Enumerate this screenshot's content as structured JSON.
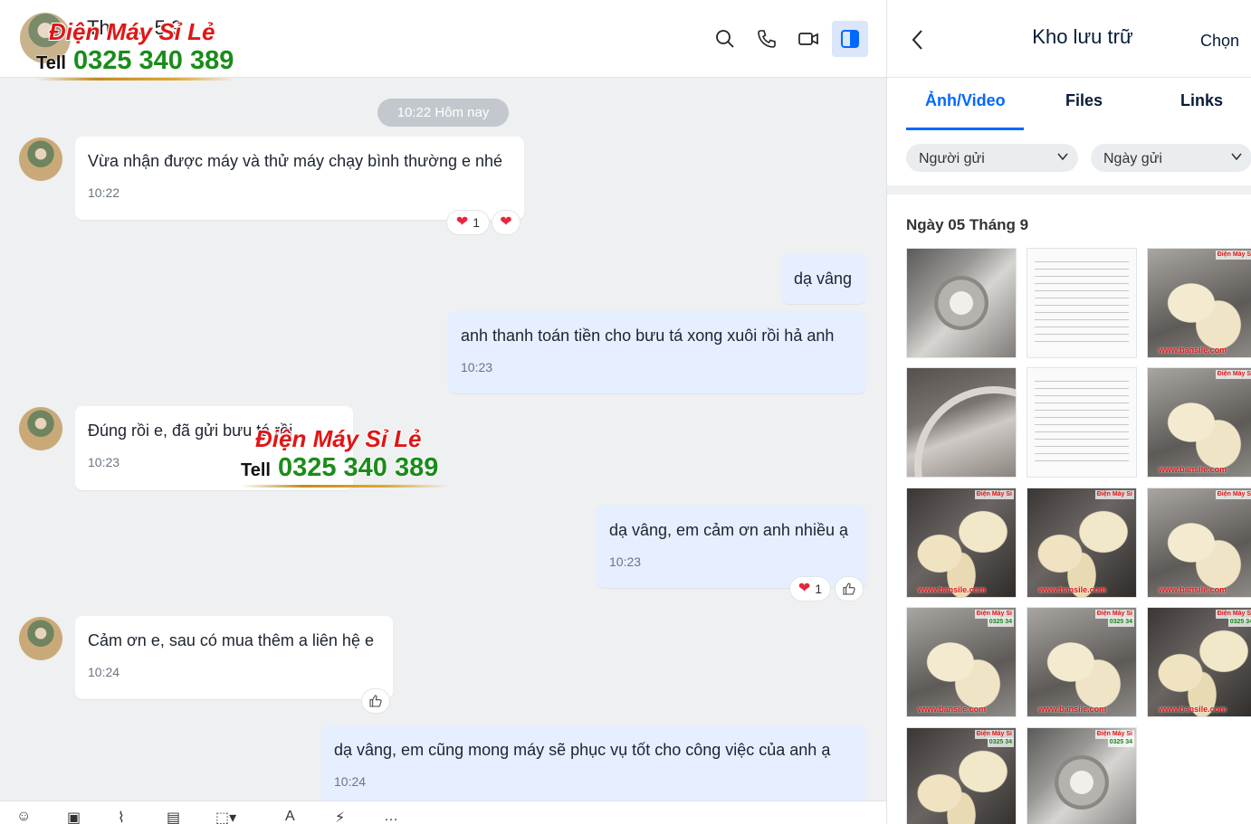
{
  "chat": {
    "header": {
      "name": "Th... ... 5.9",
      "icons": [
        "search-icon",
        "phone-icon",
        "video-icon",
        "panel-toggle-icon"
      ]
    },
    "date_chip": "10:22 Hôm nay",
    "messages": [
      {
        "dir": "in",
        "text": "Vừa nhận được máy và thử máy chạy bình thường e nhé",
        "time": "10:22",
        "reaction_count": "1"
      },
      {
        "dir": "out",
        "text": "dạ vâng",
        "time": ""
      },
      {
        "dir": "out",
        "text": "anh thanh toán tiền cho bưu tá xong xuôi rồi hả anh",
        "time": "10:23"
      },
      {
        "dir": "in",
        "text": "Đúng rồi e, đã gửi bưu tá rồi",
        "time": "10:23"
      },
      {
        "dir": "out",
        "text": "dạ vâng, em cảm ơn anh nhiều ạ",
        "time": "10:23",
        "reaction_count": "1"
      },
      {
        "dir": "in",
        "text": "Cảm ơn e, sau có mua thêm a liên hệ e",
        "time": "10:24"
      },
      {
        "dir": "out",
        "text": "dạ vâng, em cũng mong máy sẽ phục vụ tốt cho công việc của anh ạ",
        "time": "10:24"
      }
    ],
    "composer_icons": [
      "sticker-icon",
      "image-icon",
      "attach-icon",
      "card-icon",
      "screenshot-icon",
      "format-icon",
      "flash-icon",
      "more-icon"
    ]
  },
  "watermark": {
    "brand": "Điện Máy Sỉ Lẻ",
    "tell": "Tell",
    "phone": "0325 340 389"
  },
  "storage": {
    "title": "Kho lưu trữ",
    "choose": "Chọn",
    "tabs": [
      "Ảnh/Video",
      "Files",
      "Links"
    ],
    "active_tab": "Ảnh/Video",
    "filters": [
      "Người gửi",
      "Ngày gửi"
    ],
    "date_label": "Ngày 05 Tháng 9",
    "thumb_tag_brand": "Điện Máy Sỉ",
    "thumb_tag_phone": "0325 34",
    "thumb_url": "www.bansile.com",
    "colors": {
      "accent": "#0068ff",
      "bubble_out": "#e5efff",
      "heart": "#e8263c"
    }
  }
}
